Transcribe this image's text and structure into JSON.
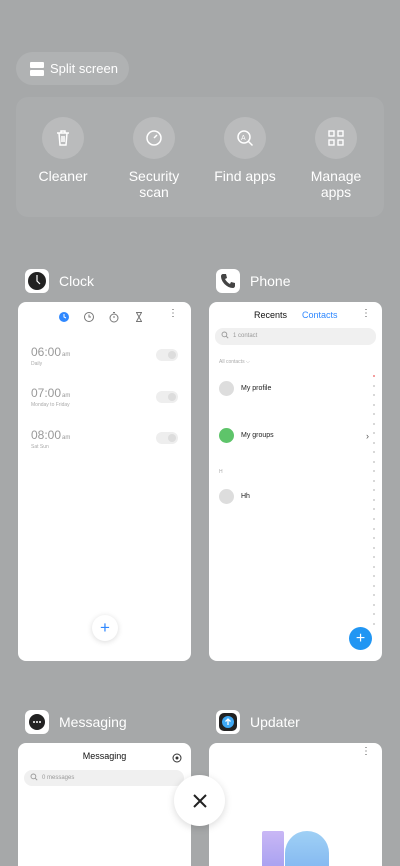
{
  "split_screen": {
    "label": "Split screen"
  },
  "quick_actions": [
    {
      "label": "Cleaner",
      "icon": "trash-icon"
    },
    {
      "label": "Security scan",
      "icon": "speedometer-icon"
    },
    {
      "label": "Find apps",
      "icon": "search-app-icon"
    },
    {
      "label": "Manage apps",
      "icon": "grid-icon"
    }
  ],
  "recent_apps": {
    "clock": {
      "name": "Clock",
      "alarms": [
        {
          "time": "06:00",
          "ampm": "am",
          "days": "Daily"
        },
        {
          "time": "07:00",
          "ampm": "am",
          "days": "Monday to Friday"
        },
        {
          "time": "08:00",
          "ampm": "am",
          "days": "Sat Sun"
        }
      ]
    },
    "phone": {
      "name": "Phone",
      "tab_recents": "Recents",
      "tab_contacts": "Contacts",
      "search_placeholder": "1 contact",
      "all_contacts": "All contacts",
      "my_profile": "My profile",
      "my_groups": "My groups",
      "section_letter": "H",
      "contact_name": "Hh"
    },
    "messaging": {
      "name": "Messaging",
      "title": "Messaging",
      "search_placeholder": "0 messages"
    },
    "updater": {
      "name": "Updater"
    }
  },
  "colors": {
    "accent_blue": "#2f88ff",
    "fab_blue": "#2196f3",
    "background": "#a6a8a9"
  }
}
